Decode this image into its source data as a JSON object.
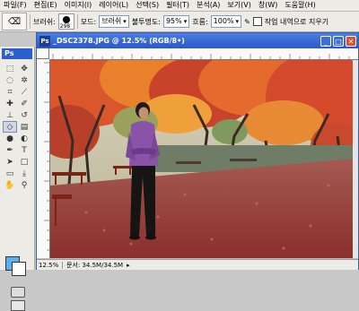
{
  "menubar": {
    "items": [
      "파일(F)",
      "편집(E)",
      "이미지(I)",
      "레이어(L)",
      "선택(S)",
      "필터(T)",
      "분석(A)",
      "보기(V)",
      "창(W)",
      "도움말(H)"
    ]
  },
  "options": {
    "brush_label": "브러쉬:",
    "brush_size": "298",
    "mode_label": "모드:",
    "mode_value": "브러쉬",
    "opacity_label": "불투명도:",
    "opacity_value": "95%",
    "flow_label": "흐름:",
    "flow_value": "100%",
    "history_label": "작업 내역으로 지우기"
  },
  "toolbox": {
    "logo": "Ps",
    "fg_color": "#5ab0f0",
    "bg_color": "#ffffff"
  },
  "document": {
    "title": "_DSC2378.JPG @ 12.5% (RGB/8•)",
    "minimize": "_",
    "maximize": "□",
    "close": "✕"
  },
  "status": {
    "zoom": "12.5%",
    "doc_size": "문서: 34.5M/34.5M"
  }
}
